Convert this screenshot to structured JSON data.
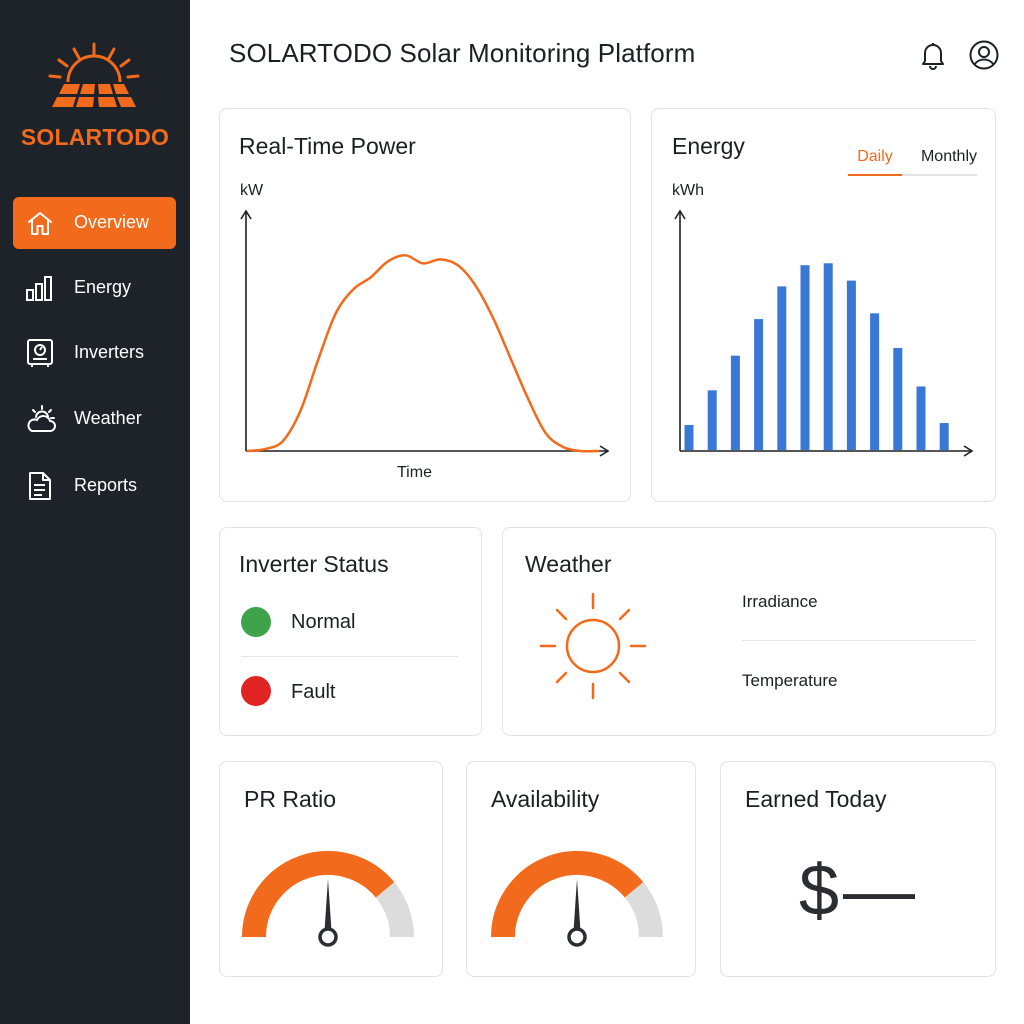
{
  "app": {
    "brand": "SOLARTODO",
    "title": "SOLARTODO Solar Monitoring Platform",
    "accent_color": "#f26a1b",
    "sidebar_color": "#1e232a"
  },
  "sidebar": {
    "items": [
      {
        "label": "Overview",
        "icon": "home-icon",
        "active": true
      },
      {
        "label": "Energy",
        "icon": "bar-chart-icon",
        "active": false
      },
      {
        "label": "Inverters",
        "icon": "inverter-icon",
        "active": false
      },
      {
        "label": "Weather",
        "icon": "sun-cloud-icon",
        "active": false
      },
      {
        "label": "Reports",
        "icon": "document-icon",
        "active": false
      }
    ]
  },
  "header": {
    "icons": [
      "bell-icon",
      "user-icon"
    ]
  },
  "realtime": {
    "title": "Real-Time Power",
    "ylabel": "kW",
    "xlabel": "Time"
  },
  "energy": {
    "title": "Energy",
    "ylabel": "kWh",
    "tabs": [
      {
        "label": "Daily",
        "active": true
      },
      {
        "label": "Monthly",
        "active": false
      }
    ]
  },
  "chart_data": [
    {
      "type": "line",
      "xlabel": "Time",
      "ylabel": "kW",
      "color": "#f26a1b",
      "x": [
        0,
        1,
        2,
        3,
        4,
        5,
        6,
        7,
        8,
        9,
        10,
        11,
        12,
        13,
        14,
        15,
        16,
        17,
        18,
        19,
        20
      ],
      "values": [
        0,
        1,
        5,
        20,
        45,
        68,
        80,
        86,
        94,
        97,
        93,
        95,
        92,
        82,
        66,
        46,
        26,
        9,
        2,
        0,
        0
      ],
      "ylim": [
        0,
        115
      ]
    },
    {
      "type": "bar",
      "ylabel": "kWh",
      "color": "#3a78d8",
      "values": [
        13,
        31,
        49,
        68,
        85,
        96,
        97,
        88,
        71,
        53,
        33,
        14
      ],
      "ylim": [
        0,
        120
      ]
    }
  ],
  "inverter_status": {
    "title": "Inverter Status",
    "items": [
      {
        "label": "Normal",
        "color": "#3ea34a"
      },
      {
        "label": "Fault",
        "color": "#e02424"
      }
    ]
  },
  "weather": {
    "title": "Weather",
    "icon": "sun-icon",
    "irradiance_label": "Irradiance",
    "temperature_label": "Temperature"
  },
  "kpis": {
    "pr_ratio": {
      "title": "PR Ratio",
      "level": 0.78
    },
    "availability": {
      "title": "Availability",
      "level": 0.78
    },
    "earned_today": {
      "title": "Earned Today",
      "value": "$—"
    }
  },
  "gauge_colors": {
    "fill": "#f26a1b",
    "track": "#dcdcdc",
    "needle": "#2a2d32"
  }
}
